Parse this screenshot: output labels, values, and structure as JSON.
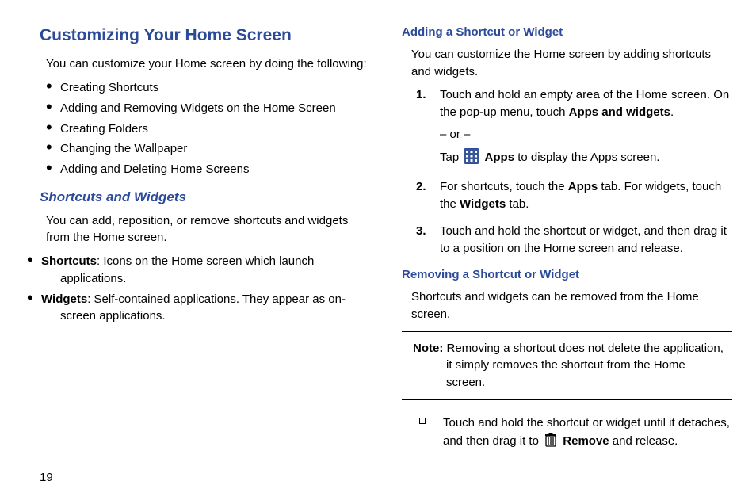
{
  "page_number": "19",
  "left": {
    "h1": "Customizing Your Home Screen",
    "intro": "You can customize your Home screen by doing the following:",
    "bullets": [
      "Creating Shortcuts",
      "Adding and Removing Widgets on the Home Screen",
      "Creating Folders",
      "Changing the Wallpaper",
      "Adding and Deleting Home Screens"
    ],
    "h2": "Shortcuts and Widgets",
    "p2": "You can add, reposition, or remove shortcuts and widgets from the Home screen.",
    "def1_term": "Shortcuts",
    "def1_rest": ": Icons on the Home screen which launch applications.",
    "def2_term": "Widgets",
    "def2_rest": ": Self-contained applications. They appear as on-screen applications."
  },
  "right": {
    "h3a": "Adding a Shortcut or Widget",
    "p1": "You can customize the Home screen by adding shortcuts and widgets.",
    "step1a": "Touch and hold an empty area of the Home screen. On the pop-up menu, touch ",
    "step1a_bold": "Apps and widgets",
    "step1a_tail": ".",
    "or": "– or –",
    "step1b_pre": "Tap ",
    "step1b_bold": "Apps",
    "step1b_post": " to display the Apps screen.",
    "step2_pre": "For shortcuts, touch the ",
    "step2_b1": "Apps",
    "step2_mid": " tab. For widgets, touch the ",
    "step2_b2": "Widgets",
    "step2_post": " tab.",
    "step3": "Touch and hold the shortcut or widget, and then drag it to a position on the Home screen and release.",
    "h3b": "Removing a Shortcut or Widget",
    "p2": "Shortcuts and widgets can be removed from the Home screen.",
    "note_label": "Note:",
    "note_body": " Removing a shortcut does not delete the application, it simply removes the shortcut from the Home screen.",
    "sq_pre": "Touch and hold the shortcut or widget until it detaches, and then drag it to ",
    "sq_bold": "Remove",
    "sq_post": " and release."
  }
}
